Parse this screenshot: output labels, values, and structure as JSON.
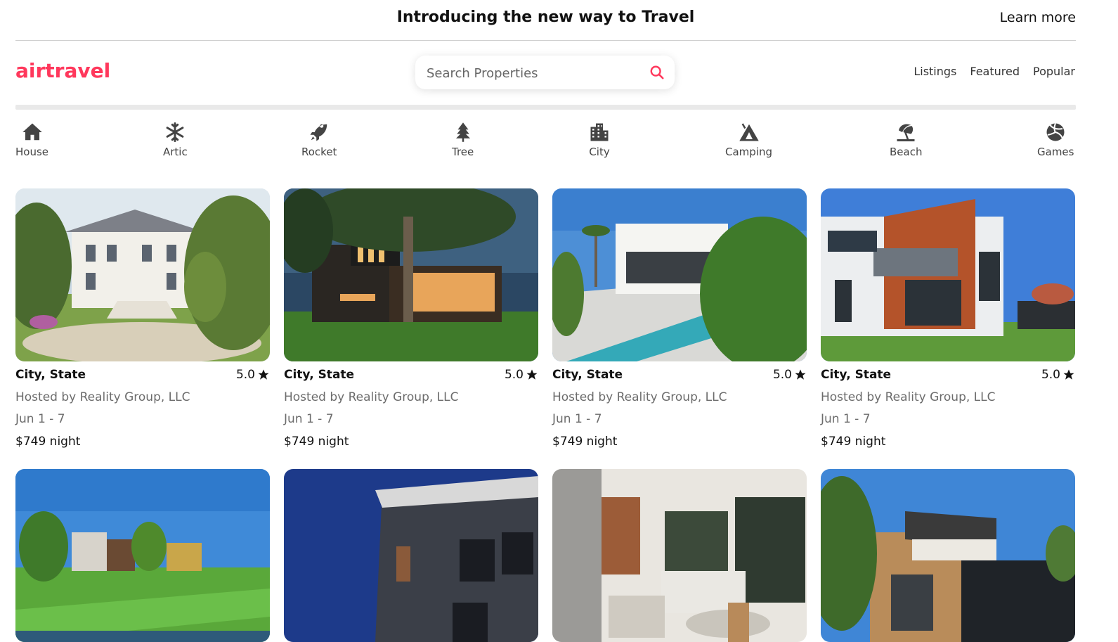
{
  "announcement": {
    "title": "Introducing the new way to Travel",
    "link": "Learn more"
  },
  "header": {
    "logo": "airtravel",
    "brand_color": "#ff385c",
    "search_placeholder": "Search Properties",
    "search_icon": "search-icon",
    "nav": [
      "Listings",
      "Featured",
      "Popular"
    ]
  },
  "categories": [
    {
      "label": "House",
      "icon": "house-icon"
    },
    {
      "label": "Artic",
      "icon": "snowflake-icon"
    },
    {
      "label": "Rocket",
      "icon": "rocket-icon"
    },
    {
      "label": "Tree",
      "icon": "tree-icon"
    },
    {
      "label": "City",
      "icon": "city-icon"
    },
    {
      "label": "Camping",
      "icon": "tent-icon"
    },
    {
      "label": "Beach",
      "icon": "umbrella-beach-icon"
    },
    {
      "label": "Games",
      "icon": "volleyball-icon"
    }
  ],
  "listings": [
    {
      "location": "City, State",
      "rating": "5.0",
      "host": "Hosted by Reality Group, LLC",
      "dates": "Jun 1 - 7",
      "price": "$749 night",
      "photo": "white mansion with garden"
    },
    {
      "location": "City, State",
      "rating": "5.0",
      "host": "Hosted by Reality Group, LLC",
      "dates": "Jun 1 - 7",
      "price": "$749 night",
      "photo": "modern dark house under tree at dusk"
    },
    {
      "location": "City, State",
      "rating": "5.0",
      "host": "Hosted by Reality Group, LLC",
      "dates": "Jun 1 - 7",
      "price": "$749 night",
      "photo": "white villa with pool"
    },
    {
      "location": "City, State",
      "rating": "5.0",
      "host": "Hosted by Reality Group, LLC",
      "dates": "Jun 1 - 7",
      "price": "$749 night",
      "photo": "modern house with copper facade"
    },
    {
      "photo": "row houses by canal"
    },
    {
      "photo": "dark brick building against blue sky"
    },
    {
      "photo": "modern living room interior"
    },
    {
      "photo": "timber clad modern house"
    }
  ]
}
